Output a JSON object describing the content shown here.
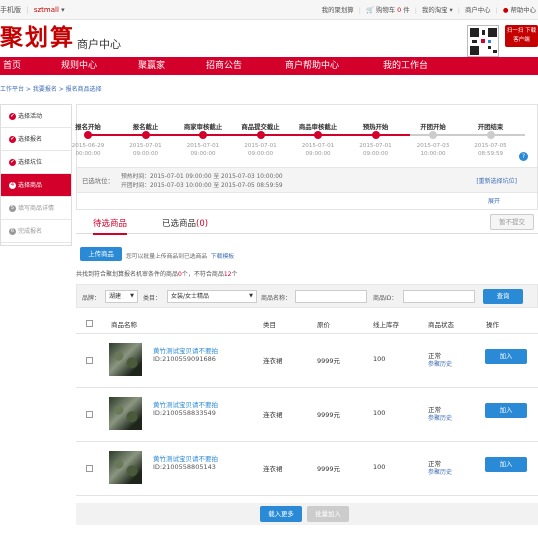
{
  "topbar": {
    "left_a": "手机版",
    "left_b": "sztmall",
    "left_c": "▾",
    "links": [
      "我的聚划算",
      "购物车",
      "0",
      "件",
      "▾",
      "我的淘宝",
      "▾",
      "商户中心",
      "帮助中心"
    ],
    "cart_label": "购物车",
    "cart_count": "0",
    "cart_unit": "件",
    "my_ju": "我的聚划算",
    "my_taobao": "我的淘宝 ▾",
    "merchant": "商户中心",
    "help": "帮助中心"
  },
  "header": {
    "logo": "聚划算",
    "subtitle": "商户中心",
    "promo": "扫一扫 下载客户端"
  },
  "nav": {
    "items": [
      "首页",
      "规则中心",
      "聚赢家",
      "招商公告",
      "商户帮助中心",
      "我的工作台"
    ]
  },
  "breadcrumb": "工作平台 > 我要报名 > 报名商品选择",
  "sidebar": {
    "items": [
      {
        "icon": "✔",
        "label": "选择活动"
      },
      {
        "icon": "✔",
        "label": "选择报名"
      },
      {
        "icon": "✔",
        "label": "选择坑位"
      },
      {
        "icon": "4",
        "label": "选择商品"
      },
      {
        "icon": "5",
        "label": "填写商品详情"
      },
      {
        "icon": "6",
        "label": "完成报名"
      }
    ]
  },
  "steps": [
    {
      "label": "报名开始",
      "date": "2015-06-29",
      "time": "00:00:00",
      "done": true
    },
    {
      "label": "报名截止",
      "date": "2015-07-01",
      "time": "09:00:00",
      "done": true
    },
    {
      "label": "商家审核截止",
      "date": "2015-07-01",
      "time": "09:00:00",
      "done": true
    },
    {
      "label": "商品提交截止",
      "date": "2015-07-01",
      "time": "09:00:00",
      "done": true
    },
    {
      "label": "商品审核截止",
      "date": "2015-07-01",
      "time": "09:00:00",
      "done": true
    },
    {
      "label": "预热开始",
      "date": "2015-07-01",
      "time": "09:00:00",
      "done": true
    },
    {
      "label": "开团开始",
      "date": "2015-07-03",
      "time": "10:00:00",
      "done": false
    },
    {
      "label": "开团结束",
      "date": "2015-07-05",
      "time": "08:59:59",
      "done": false
    }
  ],
  "selected_slot": {
    "label": "已选坑位：",
    "preheat": "预热时间：2015-07-01 09:00:00 至 2015-07-03 10:00:00",
    "opening": "开团时间：2015-07-03 10:00:00 至 2015-07-05 08:59:59",
    "reselect": "[重新选择坑位]",
    "expand": "展开",
    "help_icon": "?"
  },
  "tabs": {
    "pending": "待选商品",
    "selected": "已选商品",
    "selected_count": "(0)",
    "submit": "暂不提交"
  },
  "upload": {
    "button": "上传商品",
    "hint": "您可以批量上传商品到已选商品",
    "template": "下载模板"
  },
  "found": {
    "prefix": "共找到符合聚划算报名机审条件的商品",
    "count1": "0",
    "mid": "个，不符合商品",
    "count2": "12",
    "suffix": "个"
  },
  "filter": {
    "brand_label": "品牌：",
    "brand_value": "湖建",
    "category_label": "类目：",
    "category_value": "女装/女士精品",
    "name_label": "商品名称：",
    "id_label": "商品ID：",
    "query": "查询"
  },
  "table": {
    "headers": [
      "商品名称",
      "类目",
      "原价",
      "线上库存",
      "商品状态",
      "操作"
    ],
    "rows": [
      {
        "title": "黄竹测试宝贝请不要拍",
        "id": "ID:2100559091686",
        "category": "连衣裙",
        "price": "9999元",
        "stock": "100",
        "status": "正常",
        "history": "参聚历史",
        "action": "加入"
      },
      {
        "title": "黄竹测试宝贝请不要拍",
        "id": "ID:2100558833549",
        "category": "连衣裙",
        "price": "9999元",
        "stock": "100",
        "status": "正常",
        "history": "参聚历史",
        "action": "加入"
      },
      {
        "title": "黄竹测试宝贝请不要拍",
        "id": "ID:2100558805143",
        "category": "连衣裙",
        "price": "9999元",
        "stock": "100",
        "status": "正常",
        "history": "参聚历史",
        "action": "加入"
      }
    ]
  },
  "footer": {
    "load_more": "载入更多",
    "batch_add": "批量加入"
  }
}
